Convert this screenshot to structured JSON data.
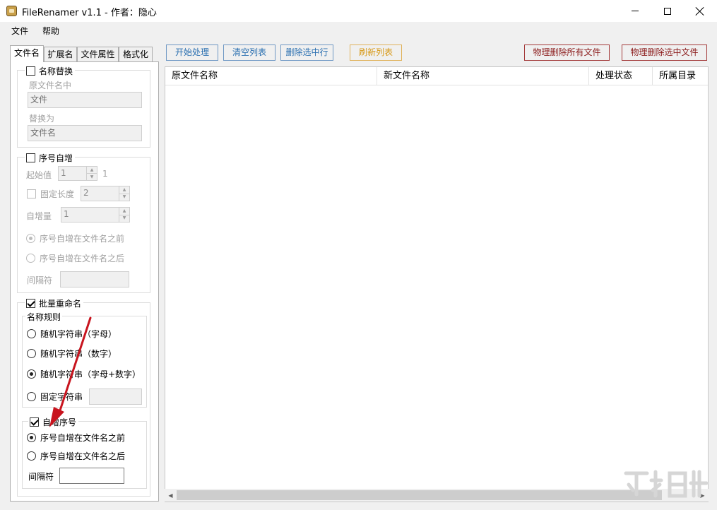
{
  "window": {
    "title": "FileRenamer v1.1 - 作者：隐心",
    "minimize_icon": "minimize-icon",
    "maximize_icon": "maximize-icon",
    "close_icon": "close-icon"
  },
  "menu": [
    "文件",
    "帮助"
  ],
  "tabs": [
    "文件名",
    "扩展名",
    "文件属性",
    "格式化"
  ],
  "active_tab": "文件名",
  "name_replace": {
    "label": "名称替换",
    "checked": false,
    "original_label": "原文件名中",
    "original_value": "文件",
    "replace_label": "替换为",
    "replace_value": "文件名"
  },
  "sequence": {
    "label": "序号自增",
    "checked": false,
    "start_label": "起始值",
    "start_value": "1",
    "start_hint": "1",
    "fixed_len_label": "固定长度",
    "fixed_len_value": "2",
    "increment_label": "自增量",
    "increment_value": "1",
    "before_option": "序号自增在文件名之前",
    "after_option": "序号自增在文件名之后",
    "separator_label": "间隔符",
    "separator_value": ""
  },
  "batch_rename": {
    "label": "批量重命名",
    "checked": true,
    "rules_label": "名称规则",
    "options": [
      "随机字符串（字母）",
      "随机字符串（数字）",
      "随机字符串（字母+数字）",
      "固定字符串"
    ],
    "selected_index": 2,
    "fixed_value": "",
    "auto_seq": {
      "label": "自增序号",
      "checked": true,
      "before_option": "序号自增在文件名之前",
      "after_option": "序号自增在文件名之后",
      "selected": "before",
      "separator_label": "间隔符",
      "separator_value": ""
    }
  },
  "toolbar": {
    "start": "开始处理",
    "clear": "清空列表",
    "delete_selected_rows": "删除选中行",
    "refresh": "刷新列表",
    "physical_delete_all": "物理删除所有文件",
    "physical_delete_selected": "物理删除选中文件"
  },
  "table": {
    "columns": [
      "原文件名称",
      "新文件名称",
      "处理状态",
      "所属目录"
    ],
    "rows": []
  },
  "colors": {
    "blue_button": "#2a6fb0",
    "orange_button": "#d79a1a",
    "red_button": "#8b1a1a",
    "annotation_arrow": "#c8141e"
  }
}
